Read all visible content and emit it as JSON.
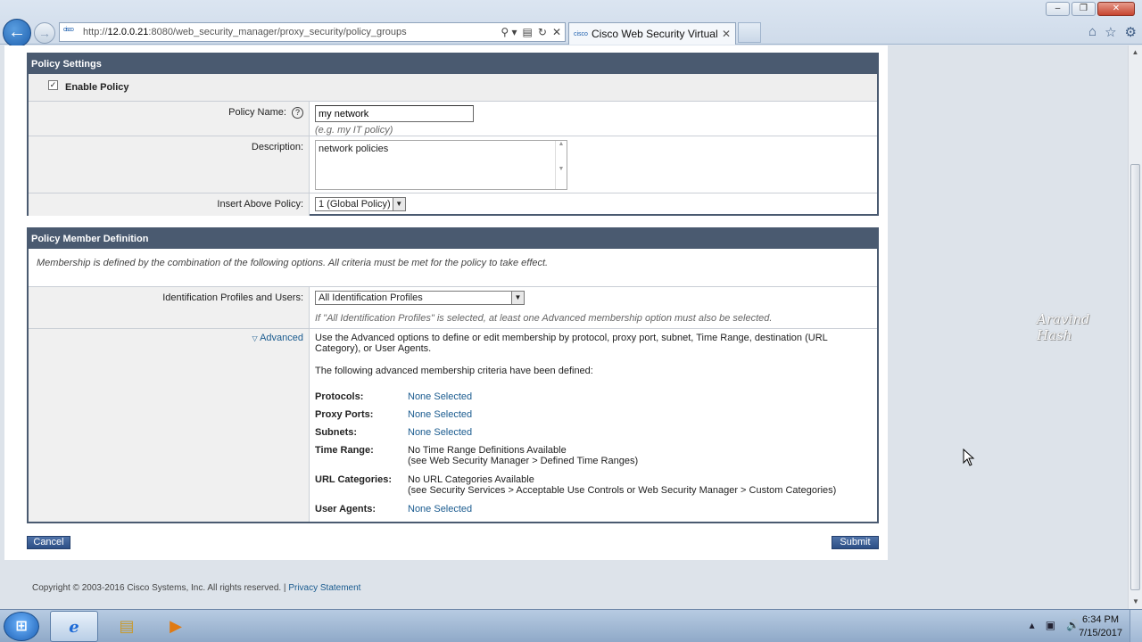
{
  "browser": {
    "url_prefix": "http://",
    "url_host": "12.0.0.21",
    "url_rest": ":8080/web_security_manager/proxy_security/policy_groups",
    "tab_title": "Cisco Web Security Virtual ...",
    "favicon_text": "cisco",
    "back_glyph": "←",
    "forward_glyph": "→",
    "tab_close": "✕",
    "address_tools": [
      "⚲ ▾",
      "▤",
      "↻",
      "✕"
    ],
    "right_icons": [
      "home-icon",
      "star-icon",
      "gear-icon"
    ],
    "right_icon_glyphs": [
      "⌂",
      "☆",
      "⚙"
    ],
    "window_buttons": [
      "–",
      "❐",
      "✕"
    ]
  },
  "policy_settings": {
    "header": "Policy Settings",
    "enable_label": "Enable Policy",
    "enable_checked": true,
    "name_label": "Policy Name:",
    "help_glyph": "?",
    "name_value": "my network",
    "name_hint": "(e.g. my IT policy)",
    "description_label": "Description:",
    "description_value": "network policies",
    "insert_label": "Insert Above Policy:",
    "insert_value": "1 (Global Policy)"
  },
  "member_definition": {
    "header": "Policy Member Definition",
    "intro": "Membership is defined by the combination of the following options. All criteria must be met for the policy to take effect.",
    "id_label": "Identification Profiles and Users:",
    "id_value": "All Identification Profiles",
    "id_hint": "If \"All Identification Profiles\" is selected, at least one Advanced membership option must also be selected.",
    "advanced_label": "Advanced",
    "advanced_text": "Use the Advanced options to define or edit membership by protocol, proxy port, subnet, Time Range, destination (URL Category), or User Agents.",
    "defined_text": "The following advanced membership criteria have been defined:",
    "criteria": [
      {
        "key": "Protocols:",
        "value": "None Selected",
        "link": true
      },
      {
        "key": "Proxy Ports:",
        "value": "None Selected",
        "link": true
      },
      {
        "key": "Subnets:",
        "value": "None Selected",
        "link": true
      },
      {
        "key": "Time Range:",
        "value": "No Time Range Definitions Available",
        "sub": "(see Web Security Manager > Defined Time Ranges)",
        "link": false
      },
      {
        "key": "URL Categories:",
        "value": "No URL Categories Available",
        "sub": "(see Security Services > Acceptable Use Controls or Web Security Manager > Custom Categories)",
        "link": false
      },
      {
        "key": "User Agents:",
        "value": "None Selected",
        "link": true
      }
    ]
  },
  "actions": {
    "cancel_label": "Cancel",
    "submit_label": "Submit"
  },
  "footer": {
    "copyright": "Copyright © 2003-2016 Cisco Systems, Inc. All rights reserved. | ",
    "privacy_link": "Privacy Statement"
  },
  "watermark": "Aravind Hash",
  "taskbar": {
    "start_glyph": "⊞",
    "items": [
      "ie-icon",
      "folder-icon",
      "media-player-icon"
    ],
    "item_glyphs": [
      "e",
      "▤",
      "▶"
    ],
    "tray_icons": [
      "show-hidden-icons",
      "network-icon",
      "volume-icon"
    ],
    "tray_glyphs": [
      "▴",
      "▣",
      "🔊"
    ],
    "time": "6:34 PM",
    "date": "7/15/2017"
  },
  "colors": {
    "section_header": "#4a5a70",
    "link": "#1a5b8f",
    "button": "#2c4f86"
  }
}
